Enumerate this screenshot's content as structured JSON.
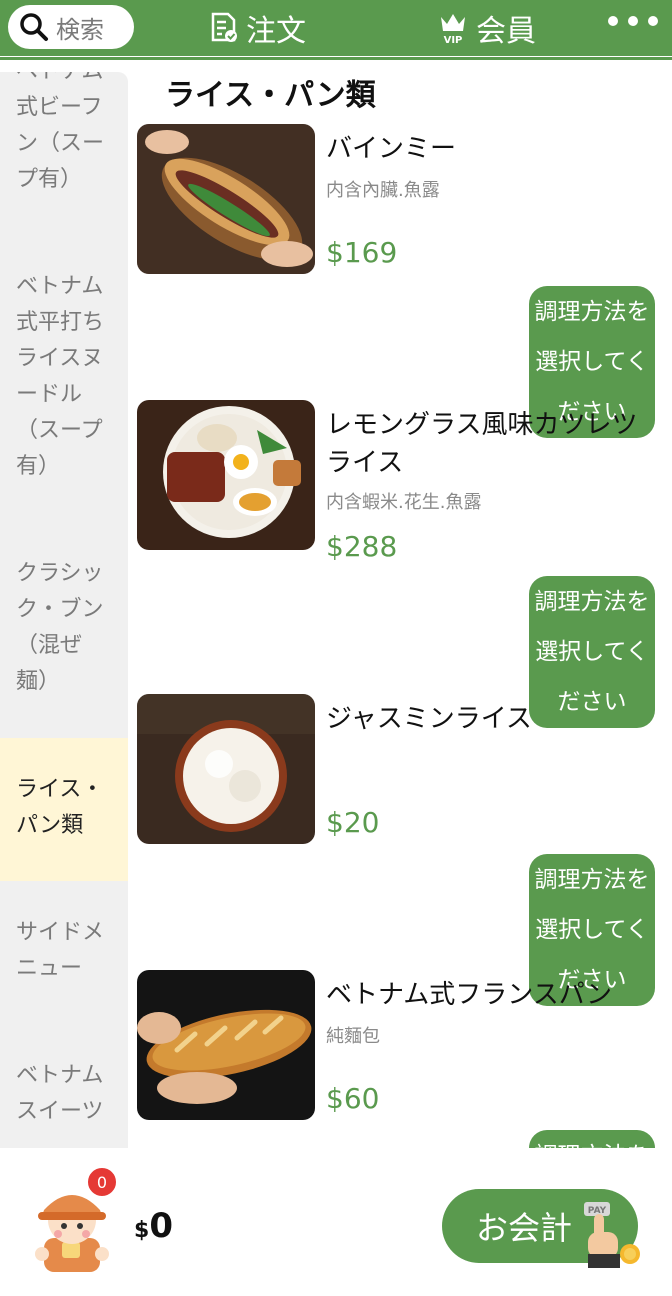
{
  "header": {
    "search_label": "検索",
    "nav_order_label": "注文",
    "nav_member_label": "会員",
    "member_icon_text": "VIP"
  },
  "sidebar": {
    "items": [
      {
        "label": "ベトナム式ビーフン（スープ有）",
        "lines": [
          "ベトナム",
          "式ビーフ",
          "ン（スー",
          "プ有）"
        ]
      },
      {
        "label": "ベトナム式平打ちライスヌードル（スープ有）",
        "lines": [
          "ベトナム",
          "式平打ち",
          "ライスヌ",
          "ードル",
          "（スープ",
          "有）"
        ]
      },
      {
        "label": "クラシック・ブン（混ぜ麺）",
        "lines": [
          "クラシッ",
          "ク・ブン",
          "（混ぜ",
          "麺）"
        ]
      },
      {
        "label": "ライス・パン類",
        "lines": [
          "ライス・",
          "パン類"
        ],
        "active": true
      },
      {
        "label": "サイドメニュー",
        "lines": [
          "サイドメ",
          "ニュー"
        ]
      },
      {
        "label": "ベトナムスイーツ",
        "lines": [
          "ベトナム",
          "スイーツ"
        ]
      }
    ]
  },
  "main": {
    "section_title": "ライス・パン類",
    "option_label_lines": [
      "調理方法を",
      "選択してく",
      "ださい"
    ],
    "products": [
      {
        "name_lines": [
          "バインミー"
        ],
        "desc": "内含內臟.魚露",
        "price": "$169"
      },
      {
        "name_lines": [
          "レモングラス風味カツレツ",
          "ライス"
        ],
        "desc": "内含蝦米.花生.魚露",
        "price": "$288"
      },
      {
        "name_lines": [
          "ジャスミンライス"
        ],
        "desc": "",
        "price": "$20"
      },
      {
        "name_lines": [
          "ベトナム式フランスパン"
        ],
        "desc": "純麵包",
        "price": "$60"
      }
    ]
  },
  "cart": {
    "badge_count": "0",
    "currency": "$",
    "total": "0",
    "checkout_label": "お会計",
    "pay_icon_text": "PAY"
  },
  "colors": {
    "brand_green": "#5a9a4e",
    "sidebar_bg": "#f0f0f0",
    "active_bg": "#fff6d6",
    "badge_red": "#e53935"
  }
}
